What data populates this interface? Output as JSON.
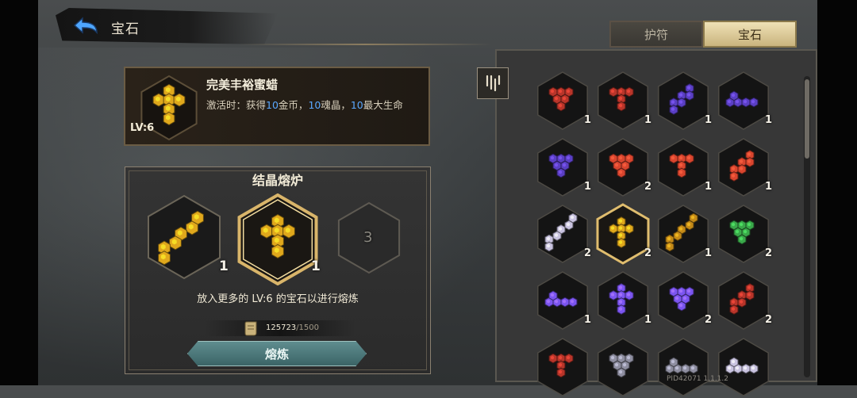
{
  "header": {
    "title": "宝石"
  },
  "tabs": [
    {
      "label": "护符",
      "active": false
    },
    {
      "label": "宝石",
      "active": true
    }
  ],
  "gem_info": {
    "name": "完美丰裕蜜蜡",
    "level": "LV:6",
    "desc_prefix": "激活时：获得",
    "v1": "10",
    "t1": "金币，",
    "v2": "10",
    "t2": "魂晶，",
    "v3": "10",
    "t3": "最大生命",
    "color": "#e0a81c"
  },
  "furnace": {
    "title": "结晶熔炉",
    "slots": [
      {
        "count": "1",
        "color": "#e0a81c",
        "shape": "diagonal",
        "selected": false
      },
      {
        "count": "1",
        "color": "#e0a81c",
        "shape": "cross",
        "selected": true
      },
      {
        "count": "",
        "label": "3",
        "empty": true
      }
    ],
    "hint": "放入更多的 LV:6 的宝石以进行熔炼",
    "cost": "125723",
    "cost_max": "/1500",
    "button": "熔炼"
  },
  "inventory": [
    {
      "color": "#b8352a",
      "shape": "tri",
      "count": "1"
    },
    {
      "color": "#b8352a",
      "shape": "tee",
      "count": "1"
    },
    {
      "color": "#5a3fc4",
      "shape": "zig",
      "count": "1"
    },
    {
      "color": "#5a3fc4",
      "shape": "line",
      "count": "1"
    },
    {
      "color": "#5a3fc4",
      "shape": "tri",
      "count": "1"
    },
    {
      "color": "#d9452e",
      "shape": "tri",
      "count": "2"
    },
    {
      "color": "#d9452e",
      "shape": "tee",
      "count": "1"
    },
    {
      "color": "#d9452e",
      "shape": "zig",
      "count": "1"
    },
    {
      "color": "#c9c3e0",
      "shape": "diagonal",
      "count": "2"
    },
    {
      "color": "#e0a81c",
      "shape": "cross",
      "count": "2",
      "selected": true
    },
    {
      "color": "#c48a18",
      "shape": "diagonal",
      "count": "1"
    },
    {
      "color": "#3aa84a",
      "shape": "tri",
      "count": "2"
    },
    {
      "color": "#7b55f0",
      "shape": "line",
      "count": "1"
    },
    {
      "color": "#7b55f0",
      "shape": "cross",
      "count": "1"
    },
    {
      "color": "#7b55f0",
      "shape": "tri",
      "count": "2"
    },
    {
      "color": "#b8352a",
      "shape": "zig",
      "count": "2"
    },
    {
      "color": "#b8352a",
      "shape": "tee",
      "count": ""
    },
    {
      "color": "#8e8ea0",
      "shape": "tri",
      "count": ""
    },
    {
      "color": "#8e8ea0",
      "shape": "line",
      "count": ""
    },
    {
      "color": "#c9c3e0",
      "shape": "line",
      "count": ""
    }
  ],
  "icons": {
    "back": "back-arrow-icon",
    "filter": "filter-icon",
    "cost": "scroll-icon"
  },
  "pid": "PID42071  1.1.1.2"
}
